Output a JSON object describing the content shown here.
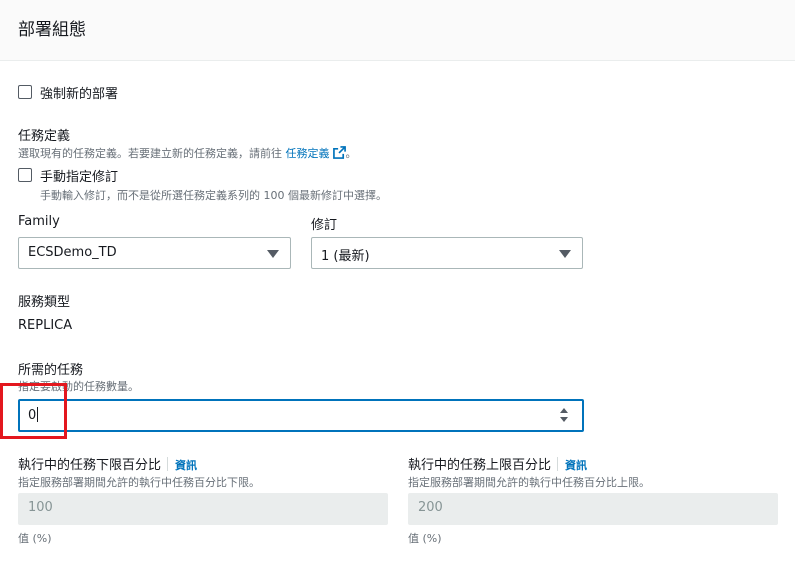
{
  "panel": {
    "title": "部署組態"
  },
  "force_deploy": {
    "label": "強制新的部署",
    "checked": false
  },
  "task_definition": {
    "label": "任務定義",
    "description_prefix": "選取現有的任務定義。若要建立新的任務定義，請前往",
    "link_text": "任務定義",
    "description_suffix": "。",
    "manual_revision": {
      "label": "手動指定修訂",
      "checked": false,
      "description": "手動輸入修訂，而不是從所選任務定義系列的 100 個最新修訂中選擇。"
    },
    "family": {
      "label": "Family",
      "value": "ECSDemo_TD"
    },
    "revision": {
      "label": "修訂",
      "value": "1 (最新)"
    }
  },
  "service_type": {
    "label": "服務類型",
    "value": "REPLICA"
  },
  "desired_tasks": {
    "label": "所需的任務",
    "description": "指定要啟動的任務數量。",
    "value": "0"
  },
  "min_healthy": {
    "label": "執行中的任務下限百分比",
    "info": "資訊",
    "description": "指定服務部署期間允許的執行中任務百分比下限。",
    "value": "100",
    "unit_label": "值 (%)"
  },
  "max_percent": {
    "label": "執行中的任務上限百分比",
    "info": "資訊",
    "description": "指定服務部署期間允許的執行中任務百分比上限。",
    "value": "200",
    "unit_label": "值 (%)"
  },
  "colors": {
    "link": "#0073bb",
    "focus_border": "#0073bb",
    "highlight": "#e3171e",
    "disabled_bg": "#eaeded"
  },
  "icons": {
    "external_link": "external-link-icon",
    "select_caret": "caret-down-icon",
    "spinner": "spinner-arrows-icon"
  }
}
